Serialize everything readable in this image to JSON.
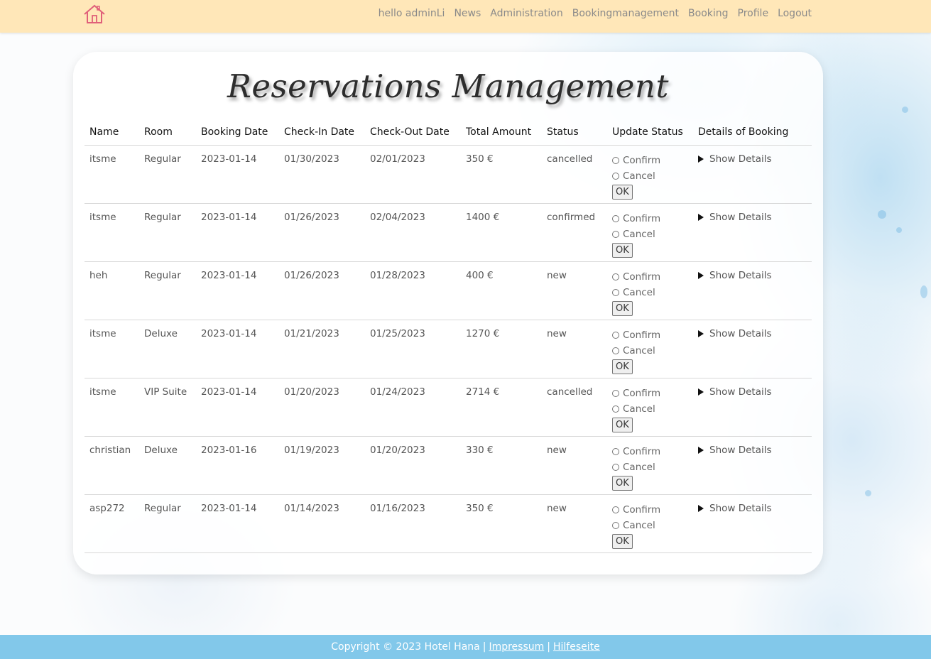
{
  "nav": {
    "greeting": "hello adminLi",
    "links": [
      "News",
      "Administration",
      "Bookingmanagement",
      "Booking",
      "Profile",
      "Logout"
    ]
  },
  "page": {
    "title": "Reservations Management"
  },
  "table": {
    "headers": [
      "Name",
      "Room",
      "Booking Date",
      "Check-In Date",
      "Check-Out Date",
      "Total Amount",
      "Status",
      "Update Status",
      "Details of Booking"
    ],
    "rows": [
      {
        "name": "itsme",
        "room": "Regular",
        "booking_date": "2023-01-14",
        "check_in": "01/30/2023",
        "check_out": "02/01/2023",
        "amount": "350 €",
        "status": "cancelled"
      },
      {
        "name": "itsme",
        "room": "Regular",
        "booking_date": "2023-01-14",
        "check_in": "01/26/2023",
        "check_out": "02/04/2023",
        "amount": "1400 €",
        "status": "confirmed"
      },
      {
        "name": "heh",
        "room": "Regular",
        "booking_date": "2023-01-14",
        "check_in": "01/26/2023",
        "check_out": "01/28/2023",
        "amount": "400 €",
        "status": "new"
      },
      {
        "name": "itsme",
        "room": "Deluxe",
        "booking_date": "2023-01-14",
        "check_in": "01/21/2023",
        "check_out": "01/25/2023",
        "amount": "1270 €",
        "status": "new"
      },
      {
        "name": "itsme",
        "room": "VIP Suite",
        "booking_date": "2023-01-14",
        "check_in": "01/20/2023",
        "check_out": "01/24/2023",
        "amount": "2714 €",
        "status": "cancelled"
      },
      {
        "name": "christian",
        "room": "Deluxe",
        "booking_date": "2023-01-16",
        "check_in": "01/19/2023",
        "check_out": "01/20/2023",
        "amount": "330 €",
        "status": "new"
      },
      {
        "name": "asp272",
        "room": "Regular",
        "booking_date": "2023-01-14",
        "check_in": "01/14/2023",
        "check_out": "01/16/2023",
        "amount": "350 €",
        "status": "new"
      }
    ],
    "confirm_label": "Confirm",
    "cancel_label": "Cancel",
    "ok_label": "OK",
    "details_label": "Show Details"
  },
  "footer": {
    "copyright": "Copyright © 2023 Hotel Hana",
    "separator": "|",
    "impressum": "Impressum",
    "help": "Hilfeseite"
  },
  "colors": {
    "navbar_bg": "#ffe7b8",
    "footer_bg": "#82c8ea",
    "logo": "#e0607a"
  },
  "icons": [
    "house-icon",
    "radio-icon",
    "disclosure-triangle-icon"
  ]
}
